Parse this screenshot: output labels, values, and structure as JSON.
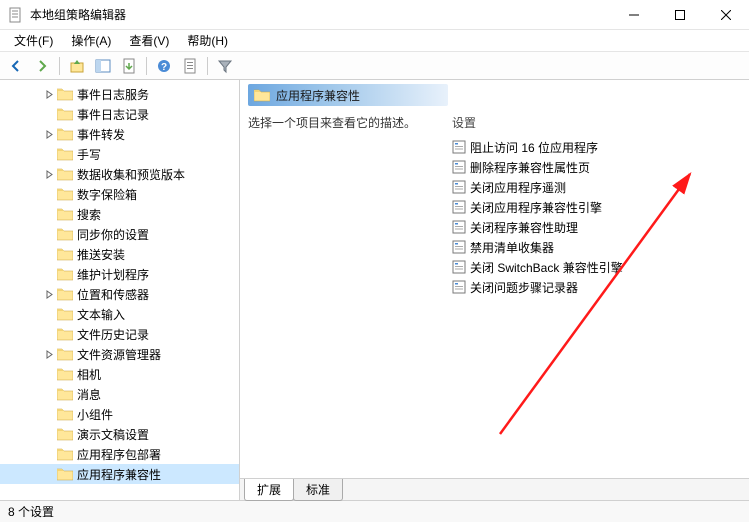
{
  "window": {
    "title": "本地组策略编辑器"
  },
  "menu": {
    "file": "文件(F)",
    "action": "操作(A)",
    "view": "查看(V)",
    "help": "帮助(H)"
  },
  "tree": {
    "items": [
      {
        "label": "事件日志服务",
        "expandable": true
      },
      {
        "label": "事件日志记录",
        "expandable": false
      },
      {
        "label": "事件转发",
        "expandable": true
      },
      {
        "label": "手写",
        "expandable": false
      },
      {
        "label": "数据收集和预览版本",
        "expandable": true
      },
      {
        "label": "数字保险箱",
        "expandable": false
      },
      {
        "label": "搜索",
        "expandable": false
      },
      {
        "label": "同步你的设置",
        "expandable": false
      },
      {
        "label": "推送安装",
        "expandable": false
      },
      {
        "label": "维护计划程序",
        "expandable": false
      },
      {
        "label": "位置和传感器",
        "expandable": true
      },
      {
        "label": "文本输入",
        "expandable": false
      },
      {
        "label": "文件历史记录",
        "expandable": false
      },
      {
        "label": "文件资源管理器",
        "expandable": true
      },
      {
        "label": "相机",
        "expandable": false
      },
      {
        "label": "消息",
        "expandable": false
      },
      {
        "label": "小组件",
        "expandable": false
      },
      {
        "label": "演示文稿设置",
        "expandable": false
      },
      {
        "label": "应用程序包部署",
        "expandable": false
      },
      {
        "label": "应用程序兼容性",
        "expandable": false,
        "selected": true
      }
    ]
  },
  "right": {
    "header": "应用程序兼容性",
    "prompt": "选择一个项目来查看它的描述。",
    "settings_header": "设置",
    "settings": [
      "阻止访问 16 位应用程序",
      "删除程序兼容性属性页",
      "关闭应用程序遥测",
      "关闭应用程序兼容性引擎",
      "关闭程序兼容性助理",
      "禁用清单收集器",
      "关闭 SwitchBack 兼容性引擎",
      "关闭问题步骤记录器"
    ]
  },
  "tabs": {
    "extended": "扩展",
    "standard": "标准"
  },
  "status": {
    "text": "8 个设置"
  }
}
